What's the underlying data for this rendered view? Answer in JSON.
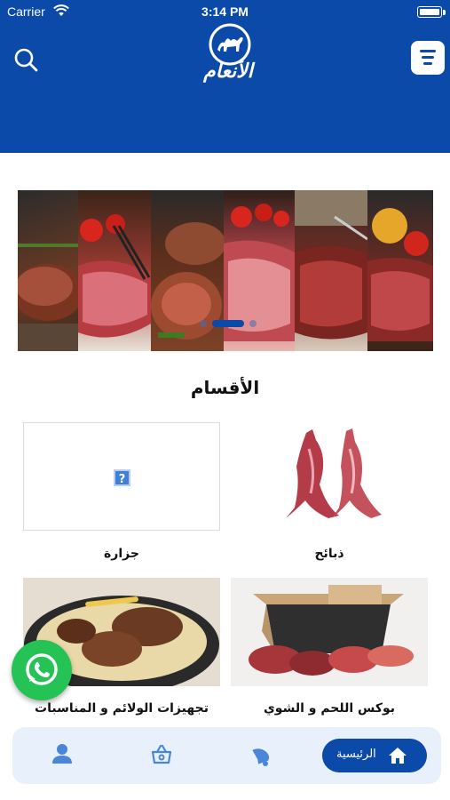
{
  "status_bar": {
    "carrier": "Carrier",
    "time": "3:14 PM"
  },
  "header": {
    "logo_text": "الأنعام",
    "search_icon": "search-icon",
    "filter_icon": "filter-icon",
    "background": "#0b4aa8"
  },
  "banner": {
    "slide_count": 3,
    "active_slide": 2
  },
  "categories": {
    "title": "الأقسام",
    "items": [
      {
        "label": "ذبائح"
      },
      {
        "label": "جزارة"
      },
      {
        "label": "بوكس اللحم و الشوي"
      },
      {
        "label": "تجهيزات الولائم و المناسبات"
      }
    ]
  },
  "tab_bar": {
    "home_label": "الرئيسية",
    "tabs": [
      "home-icon",
      "notifications-icon",
      "cart-icon",
      "profile-icon"
    ]
  },
  "colors": {
    "primary": "#0b4aa8",
    "whatsapp": "#25c256",
    "tab_bg": "#e8f1fb"
  }
}
